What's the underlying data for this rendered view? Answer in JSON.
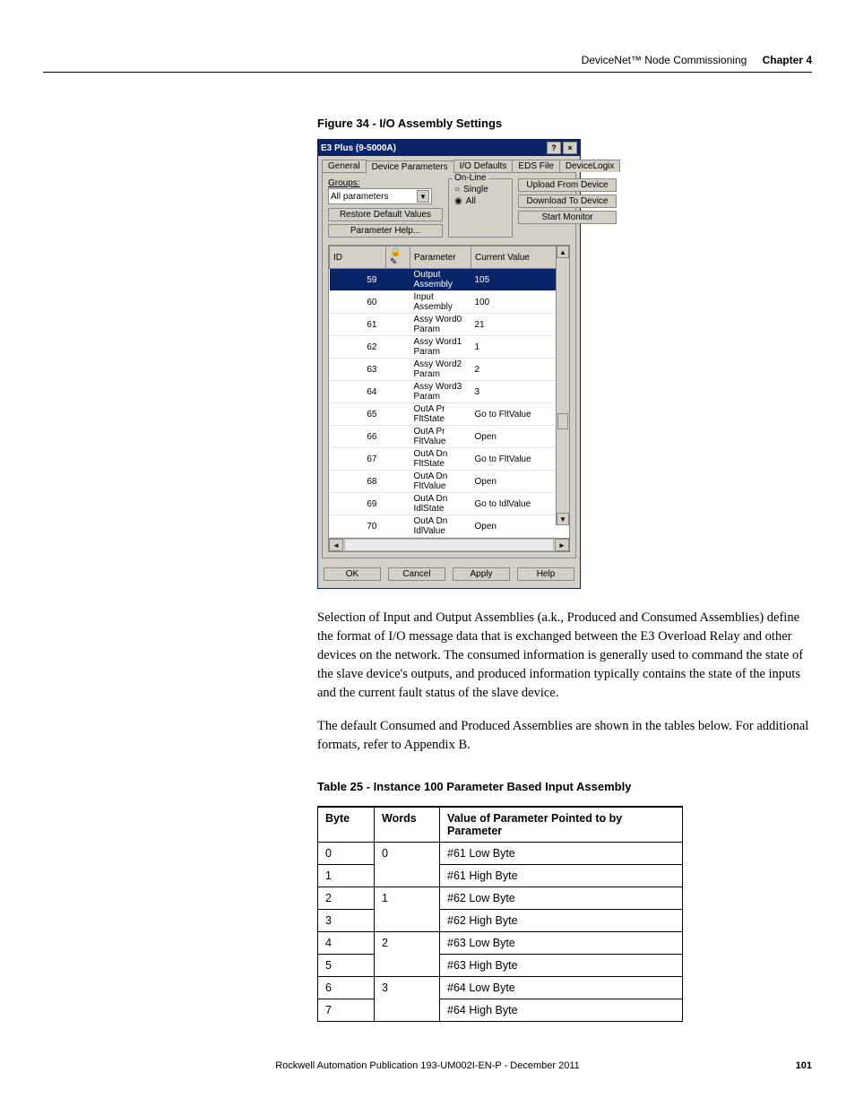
{
  "header": {
    "section": "DeviceNet™ Node Commissioning",
    "chapter": "Chapter 4"
  },
  "figure": {
    "caption": "Figure 34 - I/O Assembly Settings"
  },
  "dialog": {
    "title": "E3 Plus (9-5000A)",
    "help_btn": "?",
    "close_btn": "×",
    "tabs": {
      "general": "General",
      "device_params": "Device Parameters",
      "io_defaults": "I/O Defaults",
      "eds_file": "EDS File",
      "devicelogix": "DeviceLogix"
    },
    "groups_label": "Groups:",
    "groups_value": "All parameters",
    "restore_btn": "Restore Default Values",
    "param_help_btn": "Parameter Help...",
    "online_legend": "On-Line",
    "radio_single": "Single",
    "radio_all": "All",
    "upload_btn": "Upload From Device",
    "download_btn": "Download To Device",
    "start_monitor_btn": "Start Monitor",
    "grid": {
      "col_id": "ID",
      "col_param": "Parameter",
      "col_value": "Current Value",
      "rows": [
        {
          "id": "59",
          "param": "Output Assembly",
          "value": "105",
          "sel": true
        },
        {
          "id": "60",
          "param": "Input Assembly",
          "value": "100"
        },
        {
          "id": "61",
          "param": "Assy Word0 Param",
          "value": "21"
        },
        {
          "id": "62",
          "param": "Assy Word1 Param",
          "value": "1"
        },
        {
          "id": "63",
          "param": "Assy Word2 Param",
          "value": "2"
        },
        {
          "id": "64",
          "param": "Assy Word3 Param",
          "value": "3"
        },
        {
          "id": "65",
          "param": "OutA Pr FltState",
          "value": "Go to FltValue"
        },
        {
          "id": "66",
          "param": "OutA Pr FltValue",
          "value": "Open"
        },
        {
          "id": "67",
          "param": "OutA Dn FltState",
          "value": "Go to FltValue"
        },
        {
          "id": "68",
          "param": "OutA Dn FltValue",
          "value": "Open"
        },
        {
          "id": "69",
          "param": "OutA Dn IdlState",
          "value": "Go to IdlValue"
        },
        {
          "id": "70",
          "param": "OutA Dn IdlValue",
          "value": "Open"
        }
      ]
    },
    "buttons": {
      "ok": "OK",
      "cancel": "Cancel",
      "apply": "Apply",
      "help": "Help"
    }
  },
  "para1": "Selection of Input and Output Assemblies (a.k., Produced and Consumed Assemblies) define the format of I/O message data that is exchanged between the E3 Overload Relay and other devices on the network. The consumed information is generally used to command the state of the slave device's outputs, and produced information typically contains the state of the inputs and the current fault status of the slave device.",
  "para2": "The default Consumed and Produced Assemblies are shown in the tables below. For additional formats, refer to Appendix B.",
  "table": {
    "caption": "Table 25 - Instance 100 Parameter Based Input Assembly",
    "head": {
      "byte": "Byte",
      "words": "Words",
      "value": "Value of Parameter Pointed to by Parameter"
    },
    "rows": [
      {
        "byte": "0",
        "words": "0",
        "value": "#61 Low Byte",
        "words_rowspan": 2
      },
      {
        "byte": "1",
        "value": "#61 High Byte"
      },
      {
        "byte": "2",
        "words": "1",
        "value": "#62 Low Byte",
        "words_rowspan": 2
      },
      {
        "byte": "3",
        "value": "#62 High Byte"
      },
      {
        "byte": "4",
        "words": "2",
        "value": "#63 Low Byte",
        "words_rowspan": 2
      },
      {
        "byte": "5",
        "value": "#63 High Byte"
      },
      {
        "byte": "6",
        "words": "3",
        "value": "#64 Low Byte",
        "words_rowspan": 2
      },
      {
        "byte": "7",
        "value": "#64 High Byte"
      }
    ]
  },
  "footer": {
    "publication": "Rockwell Automation Publication 193-UM002I-EN-P - December 2011",
    "page": "101"
  }
}
